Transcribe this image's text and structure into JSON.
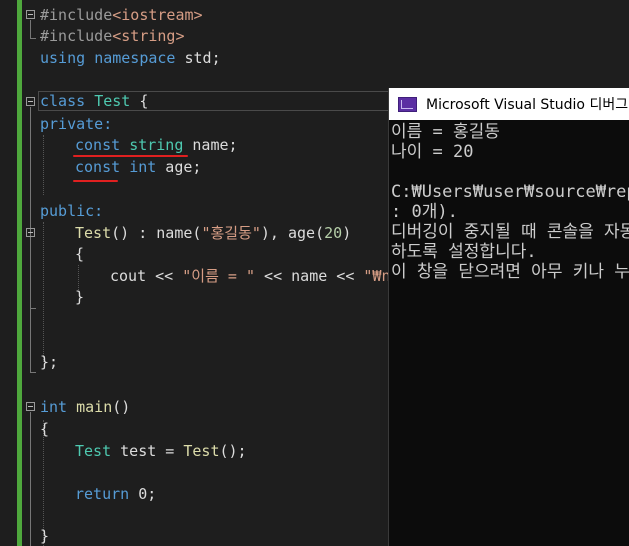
{
  "editor": {
    "lines": {
      "l1": {
        "pre": "#include",
        "inc": "<iostream>"
      },
      "l2": {
        "pre": "#include",
        "inc": "<string>"
      },
      "l3": {
        "kw1": "using",
        "kw2": "namespace",
        "rest": " std;"
      },
      "l5": {
        "kw": "class",
        "ty": "Test",
        "rest": " {"
      },
      "l6": {
        "kw": "private:"
      },
      "l7": {
        "kw": "const",
        "ty": "string",
        "rest": " name;"
      },
      "l8": {
        "kw1": "const",
        "kw2": "int",
        "rest": " age;"
      },
      "l10": {
        "kw": "public:"
      },
      "l11": {
        "fn": "Test",
        "a": "() : ",
        "b": "name",
        "c": "(",
        "s1": "\"홍길동\"",
        "d": "), ",
        "e": "age",
        "f": "(",
        "n": "20",
        "g": ")"
      },
      "l12": {
        "text": "{"
      },
      "l13": {
        "a": "cout << ",
        "s1": "\"이름 = \"",
        "b": " << name << ",
        "s2": "\"₩n"
      },
      "l14": {
        "text": "}"
      },
      "l17": {
        "text": "};"
      },
      "l19": {
        "kw": "int",
        "fn": "main",
        "rest": "()"
      },
      "l20": {
        "text": "{"
      },
      "l21": {
        "ty": "Test",
        "a": " test = ",
        "fn": "Test",
        "b": "();"
      },
      "l23": {
        "kw": "return",
        "rest": " 0;"
      },
      "l25": {
        "text": "}"
      }
    }
  },
  "console": {
    "title": "Microsoft Visual Studio 디버그 콘솔",
    "lines": [
      "이름 = 홍길동",
      "나이 = 20",
      "",
      "C:₩Users₩user₩source₩repos₩",
      ": 0개).",
      "디버깅이 중지될 때 콘솔을 자동",
      "하도록 설정합니다.",
      "이 창을 닫으려면 아무 키나 누르"
    ]
  }
}
